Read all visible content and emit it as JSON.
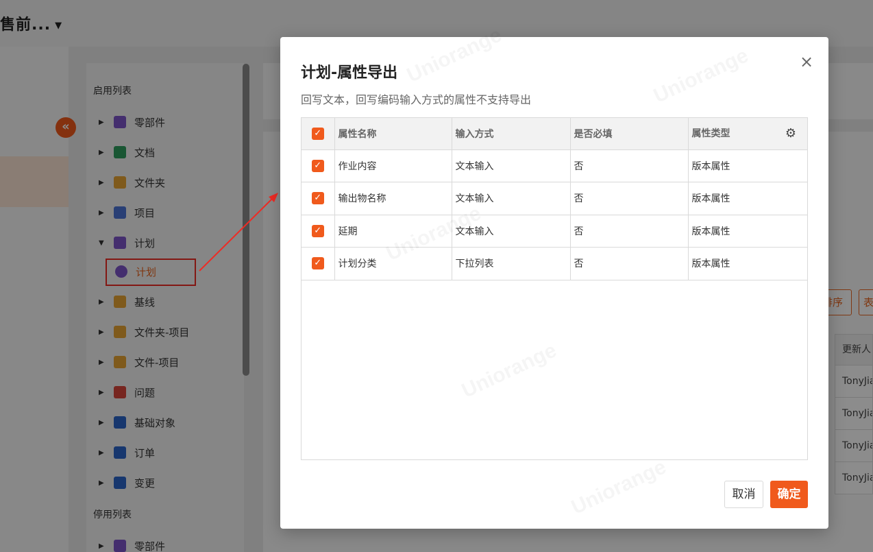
{
  "app": {
    "title": "售前...",
    "collapse_icon": "«"
  },
  "sidebar": {
    "sections": [
      {
        "label": "启用列表"
      },
      {
        "label": "停用列表"
      }
    ],
    "items": [
      {
        "label": "零部件",
        "icon": "gear-icon",
        "color": "#7d54c9"
      },
      {
        "label": "文档",
        "icon": "document-icon",
        "color": "#2e9d5e"
      },
      {
        "label": "文件夹",
        "icon": "folder-icon",
        "color": "#e8a533"
      },
      {
        "label": "项目",
        "icon": "database-icon",
        "color": "#4b73d6"
      },
      {
        "label": "计划",
        "icon": "pie-icon",
        "color": "#7d54c9"
      },
      {
        "label": "基线",
        "icon": "baseline-icon",
        "color": "#e8a533"
      },
      {
        "label": "文件夹-项目",
        "icon": "folder-icon",
        "color": "#e8a533"
      },
      {
        "label": "文件-项目",
        "icon": "file-icon",
        "color": "#e8a533"
      },
      {
        "label": "问题",
        "icon": "issue-icon",
        "color": "#d9463b"
      },
      {
        "label": "基础对象",
        "icon": "cube-icon",
        "color": "#2a64c8"
      },
      {
        "label": "订单",
        "icon": "calendar-icon",
        "color": "#2a64c8"
      },
      {
        "label": "变更",
        "icon": "change-icon",
        "color": "#2a64c8"
      },
      {
        "label": "零部件",
        "icon": "gear-icon",
        "color": "#7d54c9"
      }
    ],
    "sub_item": {
      "label": "计划",
      "icon": "pie-icon"
    }
  },
  "background": {
    "buttons": [
      "排序",
      "表"
    ],
    "table_header": "更新人",
    "table_cells": [
      "TonyJia",
      "TonyJia",
      "TonyJia",
      "TonyJia"
    ]
  },
  "modal": {
    "title": "计划-属性导出",
    "subtitle": "回写文本，回写编码输入方式的属性不支持导出",
    "close_icon": "×",
    "columns": [
      "属性名称",
      "输入方式",
      "是否必填",
      "属性类型"
    ],
    "rows": [
      {
        "name": "作业内容",
        "input": "文本输入",
        "required": "否",
        "type": "版本属性"
      },
      {
        "name": "输出物名称",
        "input": "文本输入",
        "required": "否",
        "type": "版本属性"
      },
      {
        "name": "延期",
        "input": "文本输入",
        "required": "否",
        "type": "版本属性"
      },
      {
        "name": "计划分类",
        "input": "下拉列表",
        "required": "否",
        "type": "版本属性"
      }
    ],
    "cancel_label": "取消",
    "ok_label": "确定"
  },
  "colors": {
    "accent": "#f05a1c",
    "annotation": "#ee2b24"
  }
}
